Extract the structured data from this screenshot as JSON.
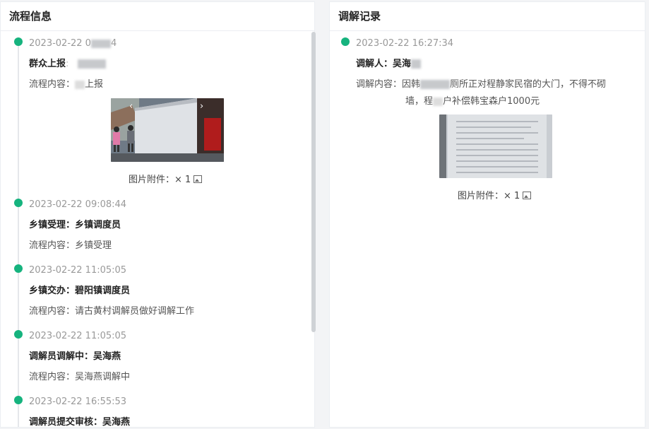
{
  "left_panel": {
    "title": "流程信息",
    "items": [
      {
        "time_visible": "2023-02-22 0",
        "time_tail": "4",
        "title_prefix": "群众上报",
        "content_prefix": "流程内容：",
        "content_tail": "上报",
        "attachment": "图片附件：× 1"
      },
      {
        "time": "2023-02-22 09:08:44",
        "title": "乡镇受理：乡镇调度员",
        "content": "流程内容：乡镇受理"
      },
      {
        "time": "2023-02-22 11:05:05",
        "title": "乡镇交办：碧阳镇调度员",
        "content": "流程内容：请古黄村调解员做好调解工作"
      },
      {
        "time": "2023-02-22 11:05:05",
        "title": "调解员调解中：吴海燕",
        "content": "流程内容：吴海燕调解中"
      },
      {
        "time": "2023-02-22 16:55:53",
        "title": "调解员提交审核：吴海燕"
      }
    ]
  },
  "right_panel": {
    "title": "调解记录",
    "record": {
      "time": "2023-02-22 16:27:34",
      "mediator_label": "调解人：吴海",
      "content_prefix": "调解内容：因韩",
      "content_line1_tail": "厕所正对程静家民宿的大门，不得不砌",
      "content_line2_head": "墙，程",
      "content_line2_tail": "户补偿韩宝森户1000元",
      "attachment": "图片附件：× 1"
    }
  },
  "icons": {
    "prev": "chevron-left-icon",
    "next": "chevron-right-icon",
    "image": "image-icon"
  },
  "colors": {
    "dot": "#16b37e",
    "line": "#e5e7eb"
  }
}
